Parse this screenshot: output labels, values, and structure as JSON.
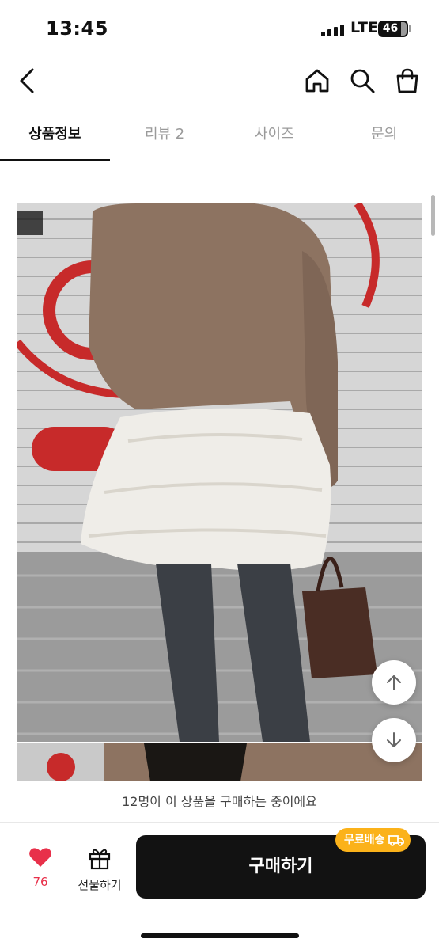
{
  "status_bar": {
    "time": "13:45",
    "network": "LTE",
    "battery": "46"
  },
  "nav": {
    "back_icon": "chevron-left-icon",
    "home_icon": "home-icon",
    "search_icon": "search-icon",
    "bag_icon": "shopping-bag-icon"
  },
  "tabs": [
    {
      "label": "상품정보",
      "active": true
    },
    {
      "label": "리뷰 2",
      "active": false
    },
    {
      "label": "사이즈",
      "active": false
    },
    {
      "label": "문의",
      "active": false
    }
  ],
  "banner": {
    "text": "12명이 이 상품을 구매하는 중이에요"
  },
  "actions": {
    "like_count": "76",
    "gift_label": "선물하기",
    "buy_label": "구매하기",
    "free_shipping_label": "무료배송"
  },
  "colors": {
    "accent_red": "#e8304a",
    "badge_yellow": "#fbb21a",
    "button_dark": "#121212"
  }
}
